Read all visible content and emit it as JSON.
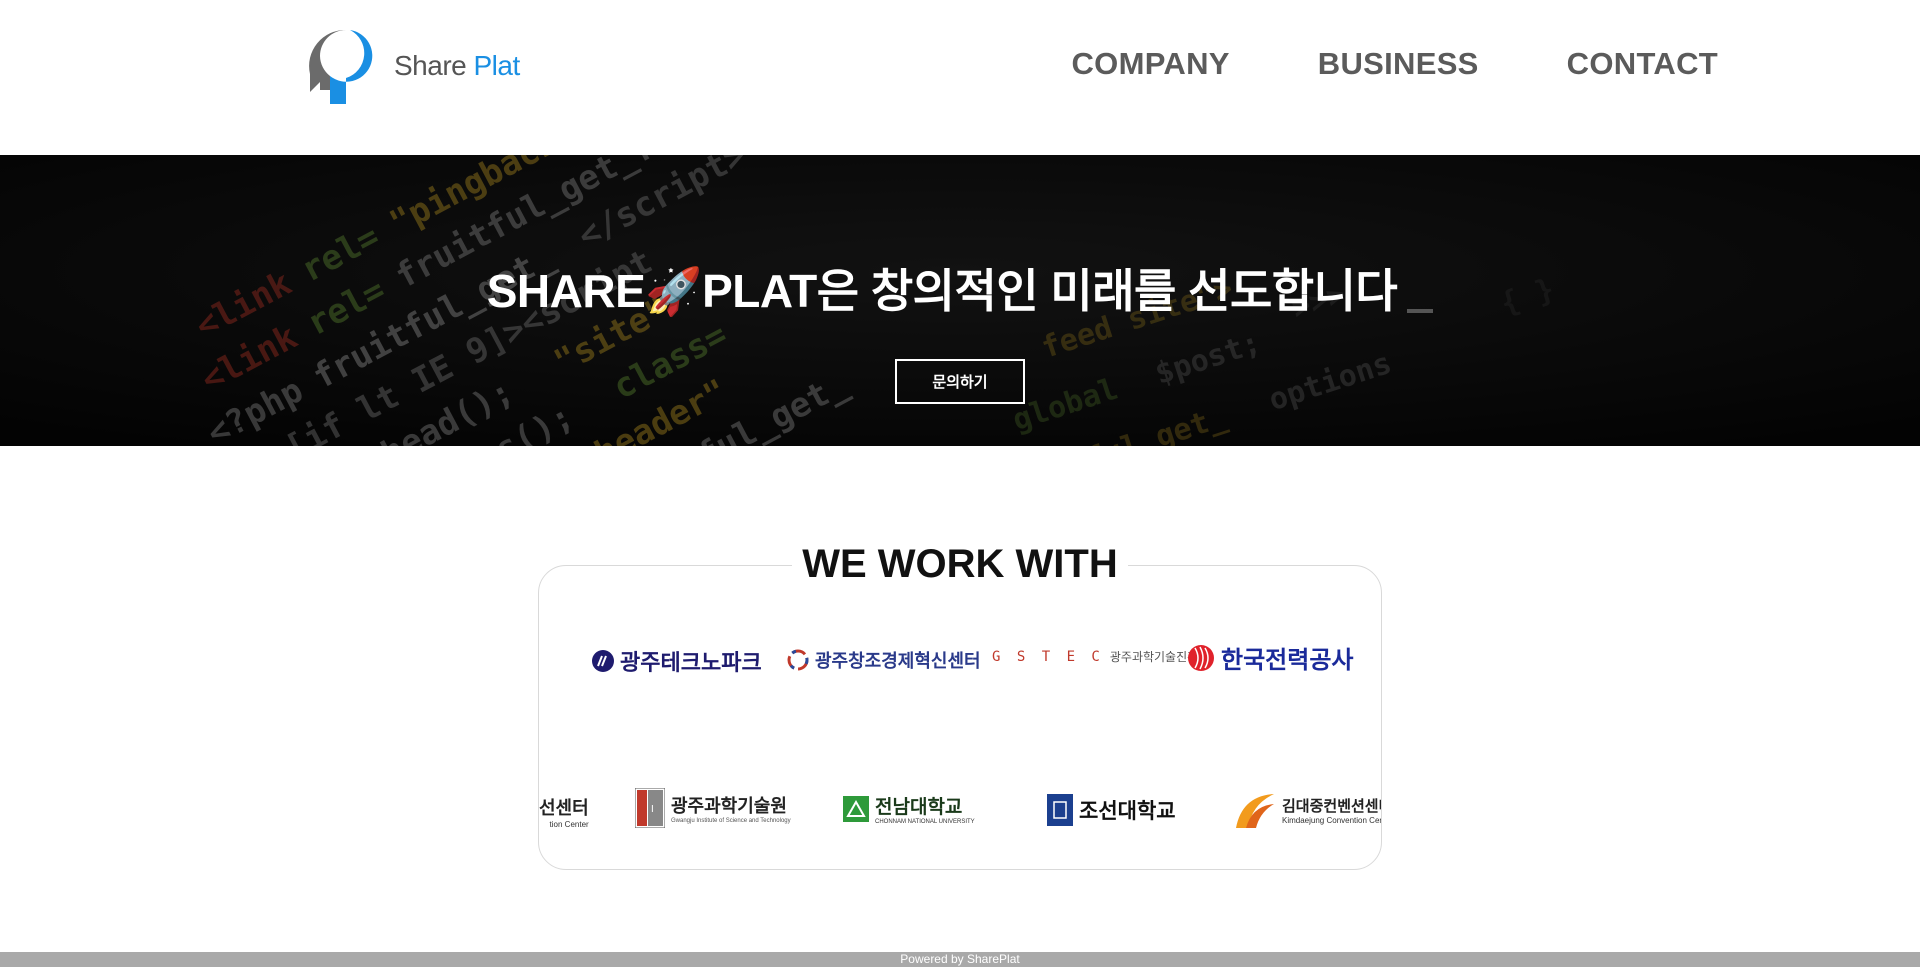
{
  "brand": {
    "name_part1": "Share",
    "name_part2": "Plat",
    "accent": "#1a8fe3"
  },
  "nav": {
    "items": [
      "COMPANY",
      "BUSINESS",
      "CONTACT"
    ]
  },
  "hero": {
    "title_part1": "SHARE",
    "title_emoji": "🚀",
    "title_part2": "PLAT은 창의적인 미래를 선도합니다",
    "button_label": "문의하기"
  },
  "partners": {
    "title": "WE WORK WITH",
    "row1": [
      {
        "name": "광주테크노파크"
      },
      {
        "name": "광주창조경제혁신센터"
      },
      {
        "name": "광주과학기술진흥원",
        "prefix": "G S T E C"
      },
      {
        "name": "한국전력공사"
      }
    ],
    "row2": [
      {
        "name": "선센터",
        "sub": "tion Center"
      },
      {
        "name": "광주과학기술원",
        "sub": "Gwangju Institute of Science and Technology"
      },
      {
        "name": "전남대학교",
        "sub": "CHONNAM NATIONAL UNIVERSITY"
      },
      {
        "name": "조선대학교"
      },
      {
        "name": "김대중컨벤션센터",
        "sub": "Kimdaejung Convention Center"
      }
    ]
  },
  "footer": {
    "text": "Powered by SharePlat"
  }
}
